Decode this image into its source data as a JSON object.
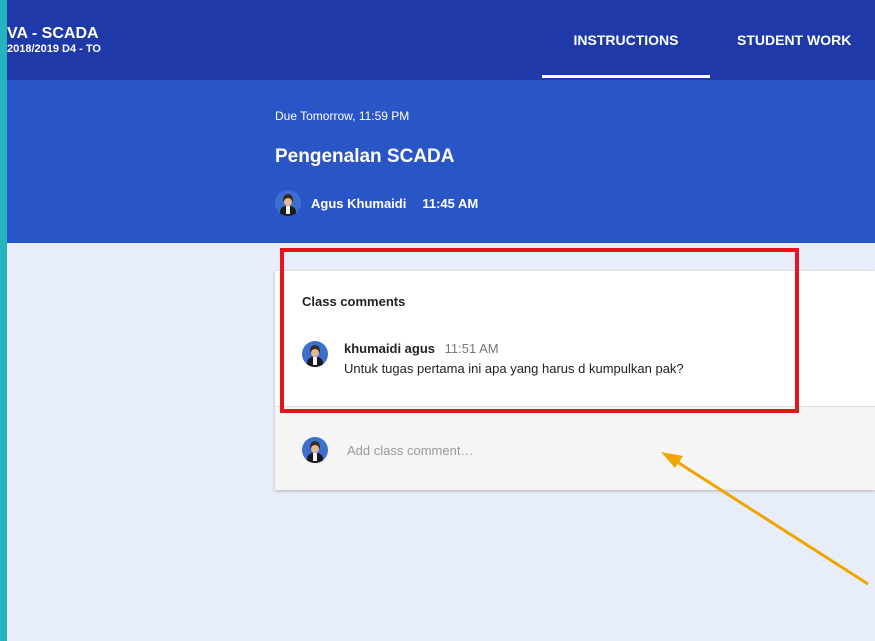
{
  "header": {
    "class_name": "VA - SCADA",
    "class_section": "2018/2019 D4 - TO",
    "tabs": [
      {
        "label": "INSTRUCTIONS",
        "active": true
      },
      {
        "label": "STUDENT WORK",
        "active": false
      }
    ]
  },
  "assignment": {
    "due": "Due Tomorrow, 11:59 PM",
    "title": "Pengenalan SCADA",
    "author": "Agus Khumaidi",
    "posted_time": "11:45 AM"
  },
  "comments": {
    "header": "Class comments",
    "items": [
      {
        "author": "khumaidi agus",
        "time": "11:51 AM",
        "text": "Untuk tugas pertama ini apa yang harus d kumpulkan pak?"
      }
    ],
    "add_placeholder": "Add class comment…"
  },
  "annotations": {
    "highlight_color": "#e8141b",
    "arrow_color": "#f0a500"
  },
  "colors": {
    "topbar": "#1f3aa8",
    "hero": "#2a55c6",
    "page_bg": "#e8eef9",
    "outer_frame": "#25b3bd"
  }
}
